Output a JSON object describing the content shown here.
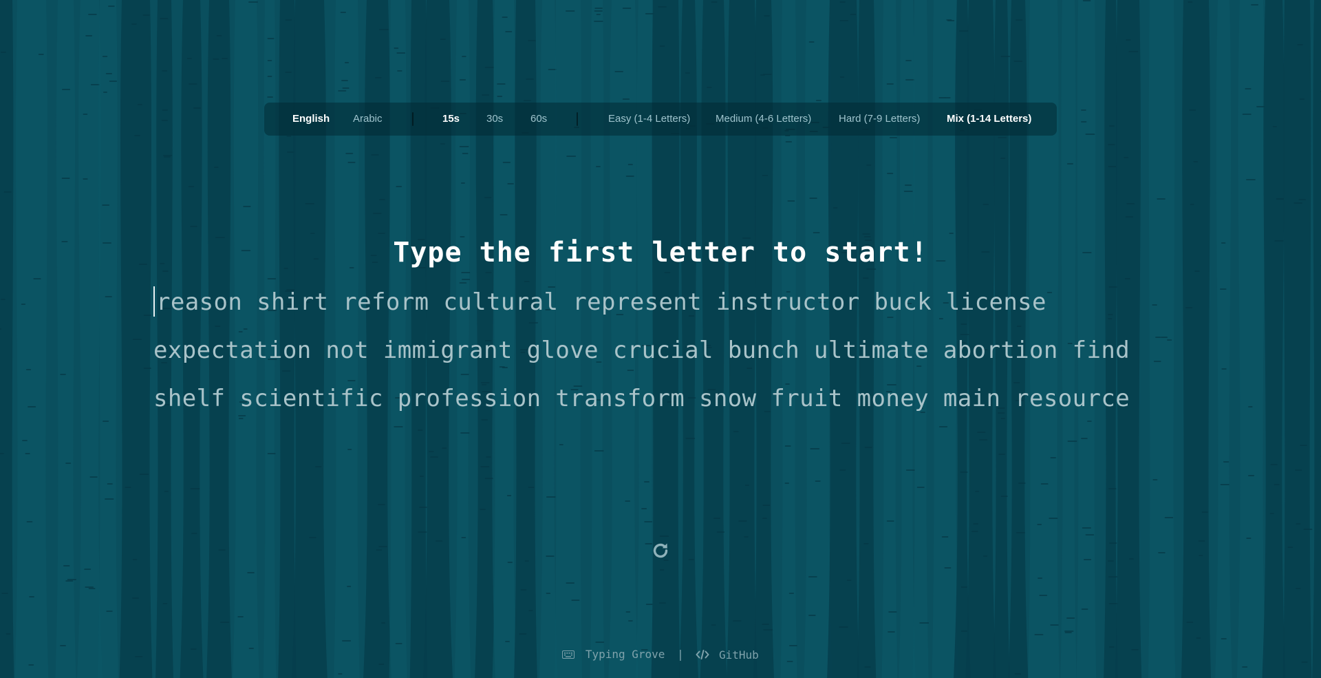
{
  "colors": {
    "background": "#0a4f5e",
    "tree_dark": "#063e4c",
    "tree_light": "#0c5867",
    "text_dim": "#a9c3c9",
    "accent_white": "#ffffff",
    "option_inactive": "#9fc4cd"
  },
  "settings": {
    "languages": [
      {
        "label": "English",
        "active": true
      },
      {
        "label": "Arabic",
        "active": false
      }
    ],
    "durations": [
      {
        "label": "15s",
        "active": true
      },
      {
        "label": "30s",
        "active": false
      },
      {
        "label": "60s",
        "active": false
      }
    ],
    "difficulties": [
      {
        "label": "Easy (1-4 Letters)",
        "active": false
      },
      {
        "label": "Medium (4-6 Letters)",
        "active": false
      },
      {
        "label": "Hard (7-9 Letters)",
        "active": false
      },
      {
        "label": "Mix (1-14 Letters)",
        "active": true
      }
    ]
  },
  "prompt": "Type the first letter to start!",
  "words": {
    "line1": "reason shirt reform cultural represent instructor buck license",
    "line2": "expectation not immigrant glove crucial bunch ultimate abortion find",
    "line3": "shelf scientific profession transform snow fruit money main resource"
  },
  "restart_icon": "restart-icon",
  "footer": {
    "app_icon": "keyboard-icon",
    "app_name": "Typing Grove",
    "divider": "|",
    "code_icon": "code-icon",
    "github_label": "GitHub"
  }
}
